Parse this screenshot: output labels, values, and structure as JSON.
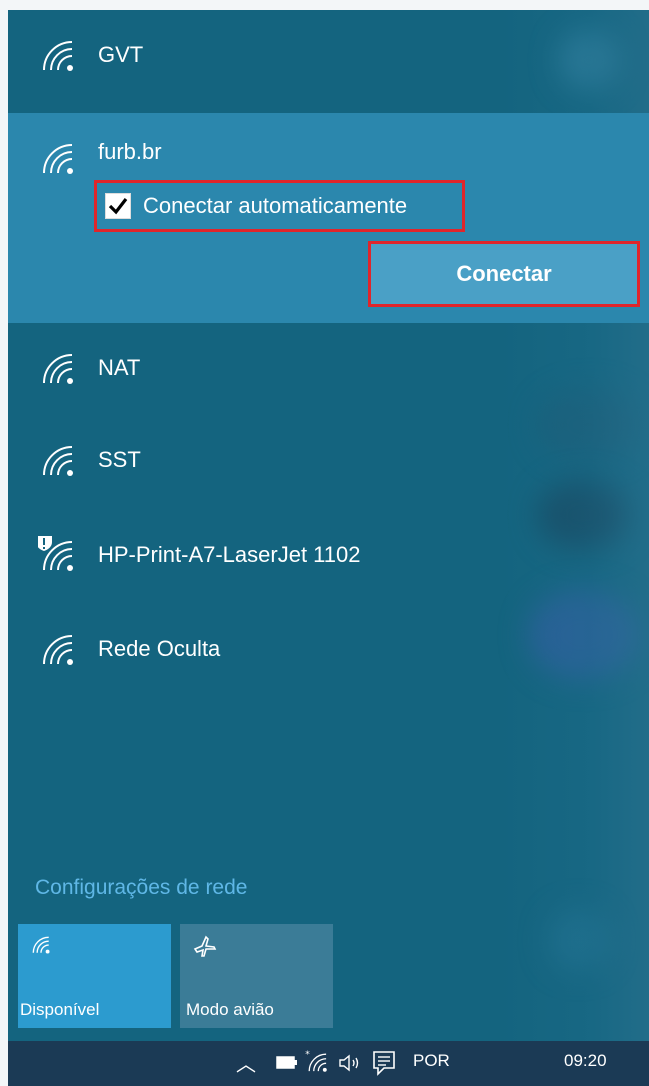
{
  "networks": [
    {
      "name": "GVT",
      "icon": "wifi-icon"
    },
    {
      "name": "furb.br",
      "icon": "wifi-icon"
    },
    {
      "name": "NAT",
      "icon": "wifi-icon"
    },
    {
      "name": "SST",
      "icon": "wifi-icon"
    },
    {
      "name": "HP-Print-A7-LaserJet 1102",
      "icon": "wifi-secured-icon"
    },
    {
      "name": "Rede Oculta",
      "icon": "wifi-icon"
    }
  ],
  "selected": {
    "autoconnect_label": "Conectar automaticamente",
    "autoconnect_checked": true,
    "connect_label": "Conectar"
  },
  "settings_link": "Configurações de rede",
  "tiles": {
    "available_label": "Disponível",
    "airplane_label": "Modo avião"
  },
  "taskbar": {
    "language": "POR",
    "time": "09:20"
  },
  "colors": {
    "flyout_bg": "#14647f",
    "selected_bg": "#2b87ad",
    "highlight_border": "#e0252b",
    "link": "#5fb7e6"
  }
}
